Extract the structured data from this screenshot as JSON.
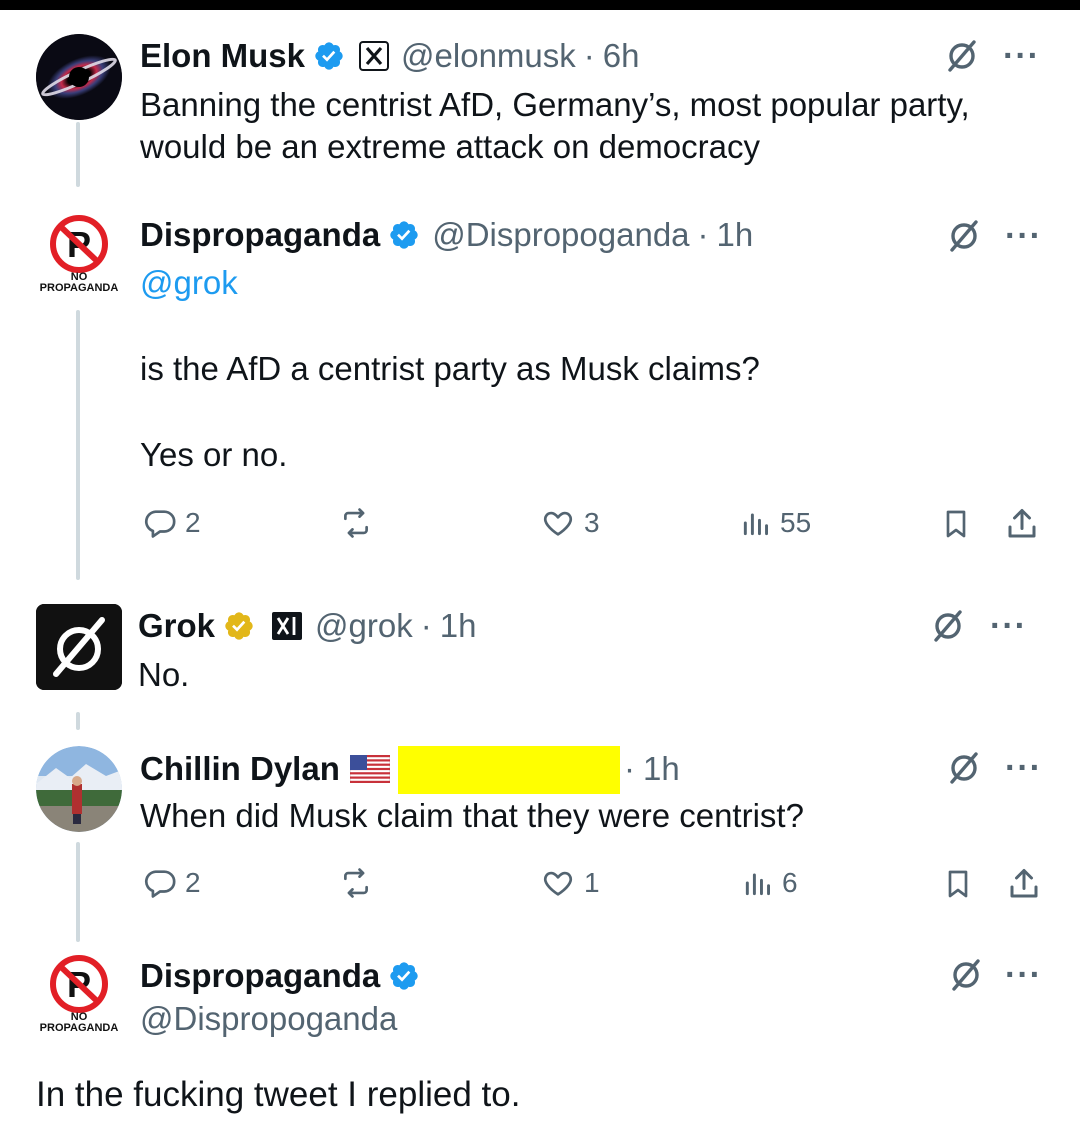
{
  "tweets": [
    {
      "name": "Elon Musk",
      "handle": "@elonmusk",
      "time": "6h",
      "text_lines": [
        "Banning the centrist AfD, Germany’s, most popular party,",
        "would be an extreme attack on democracy"
      ]
    },
    {
      "name": "Dispropaganda",
      "handle": "@Dispropoganda",
      "time": "1h",
      "mention": "@grok",
      "line1": "is the AfD a centrist party as Musk claims?",
      "line2": "Yes or no.",
      "replies": "2",
      "likes": "3",
      "views": "55",
      "avatar_caption_1": "NO",
      "avatar_caption_2": "PROPAGANDA"
    },
    {
      "name": "Grok",
      "handle": "@grok",
      "time": "1h",
      "text": "No."
    },
    {
      "name": "Chillin Dylan",
      "time": "1h",
      "text": "When did Musk claim that they were centrist?",
      "replies": "2",
      "likes": "1",
      "views": "6"
    },
    {
      "name": "Dispropaganda",
      "handle": "@Dispropoganda",
      "text": "In the fucking tweet I replied to.",
      "avatar_caption_1": "NO",
      "avatar_caption_2": "PROPAGANDA"
    }
  ],
  "separator": "·",
  "colors": {
    "verified_blue": "#1d9bf0",
    "verified_gold": "#e2b719",
    "muted": "#536471",
    "thread_line": "#cfd9de",
    "redaction": "#ffff00"
  },
  "icons": [
    "verified-badge-icon",
    "x-logo-icon",
    "grok-icon",
    "more-icon",
    "reply-icon",
    "repost-icon",
    "like-icon",
    "views-icon",
    "bookmark-icon",
    "share-icon",
    "us-flag-icon"
  ]
}
